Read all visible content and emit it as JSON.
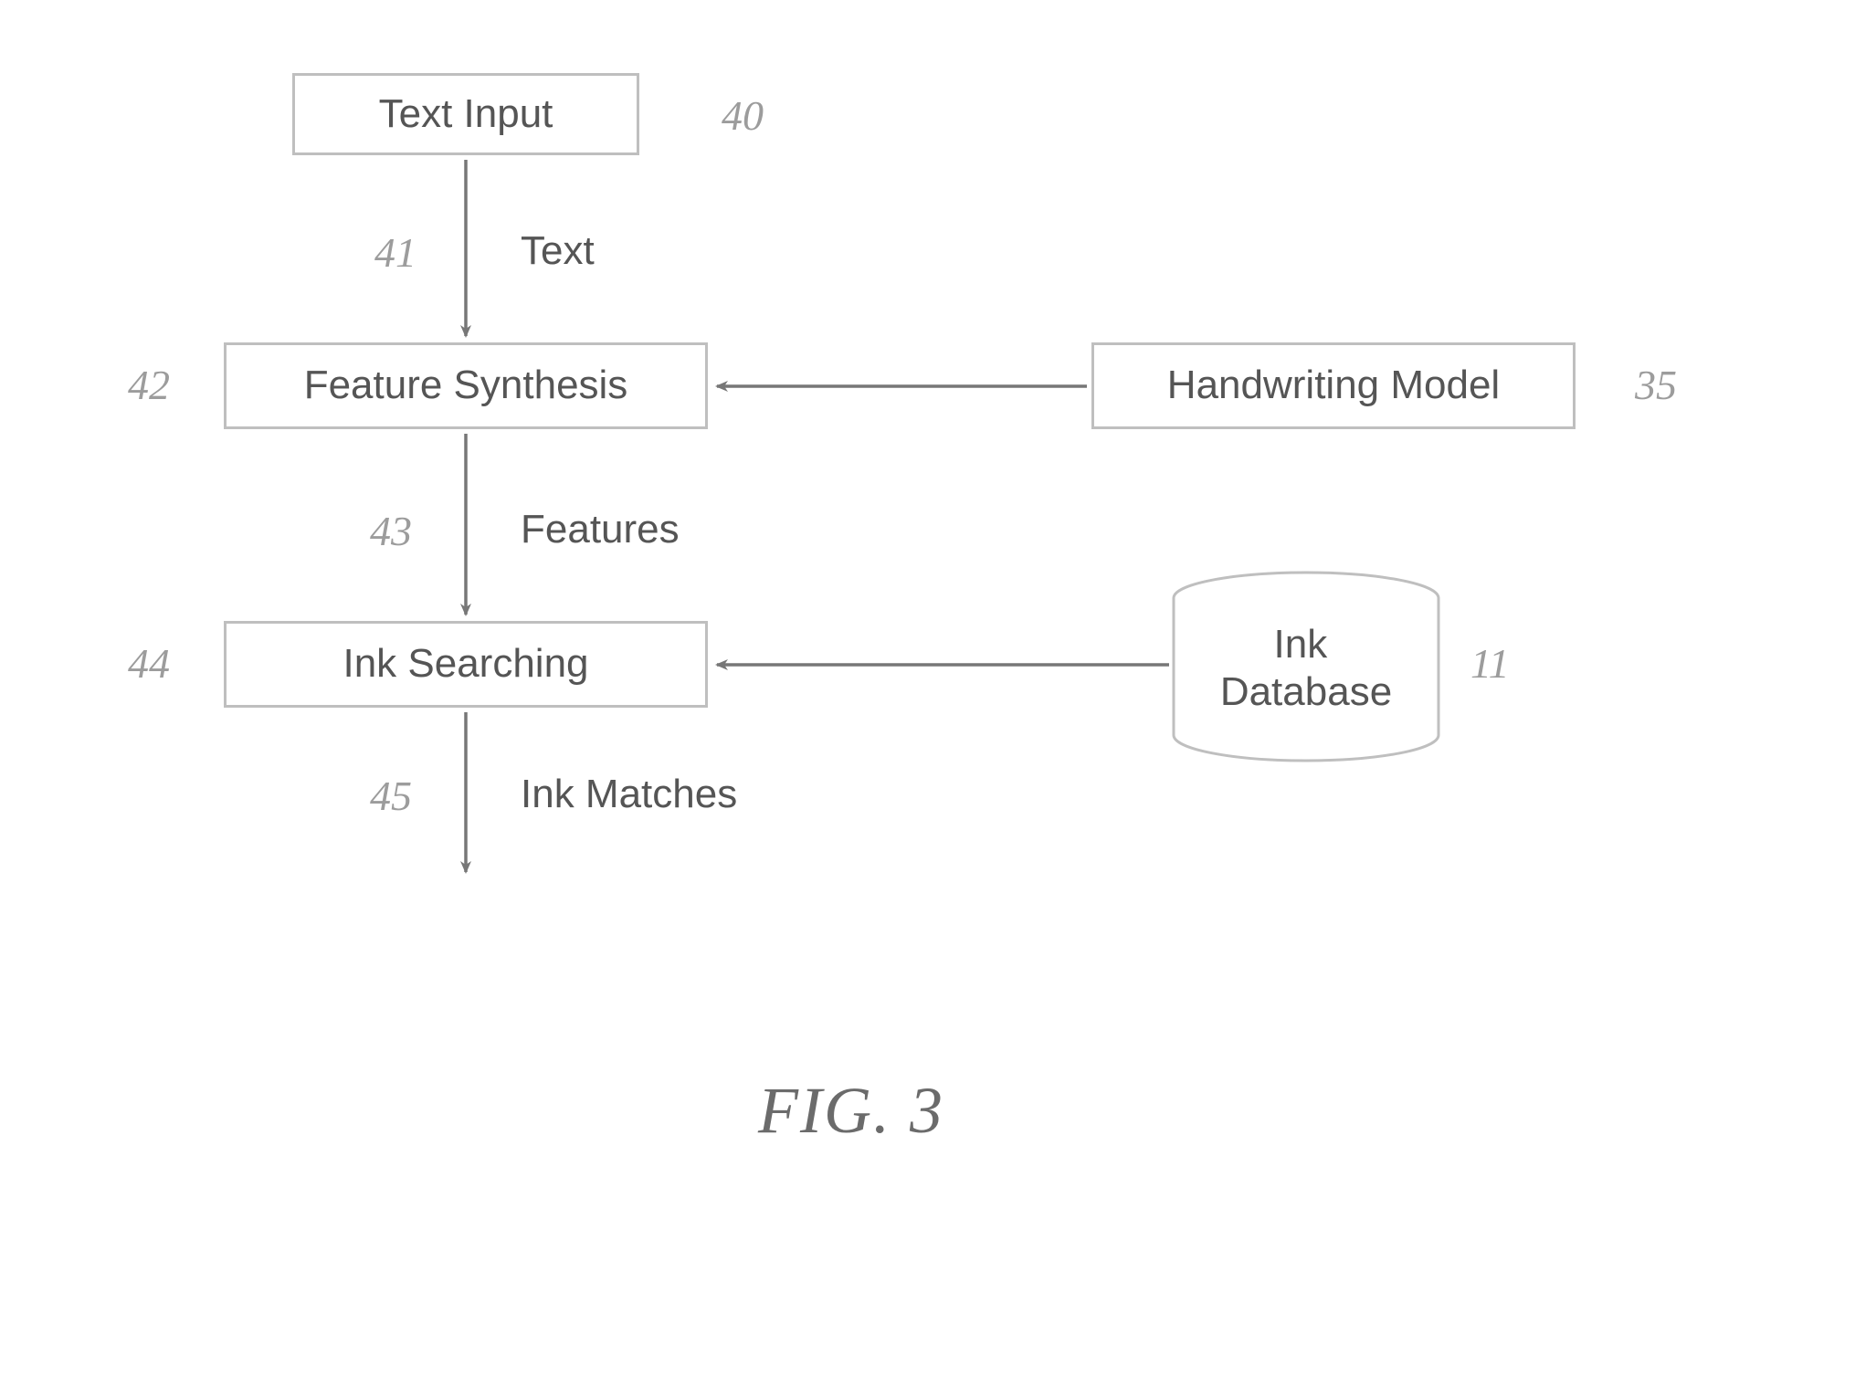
{
  "nodes": {
    "text_input": {
      "label": "Text Input",
      "ref": "40"
    },
    "feature_synthesis": {
      "label": "Feature Synthesis",
      "ref": "42"
    },
    "ink_searching": {
      "label": "Ink Searching",
      "ref": "44"
    },
    "handwriting_model": {
      "label": "Handwriting Model",
      "ref": "35"
    },
    "ink_database": {
      "label": "Ink\nDatabase",
      "ref": "11"
    }
  },
  "edges": {
    "text": {
      "label": "Text",
      "ref": "41"
    },
    "features": {
      "label": "Features",
      "ref": "43"
    },
    "ink_matches": {
      "label": "Ink Matches",
      "ref": "45"
    }
  },
  "figure_label": "FIG. 3"
}
